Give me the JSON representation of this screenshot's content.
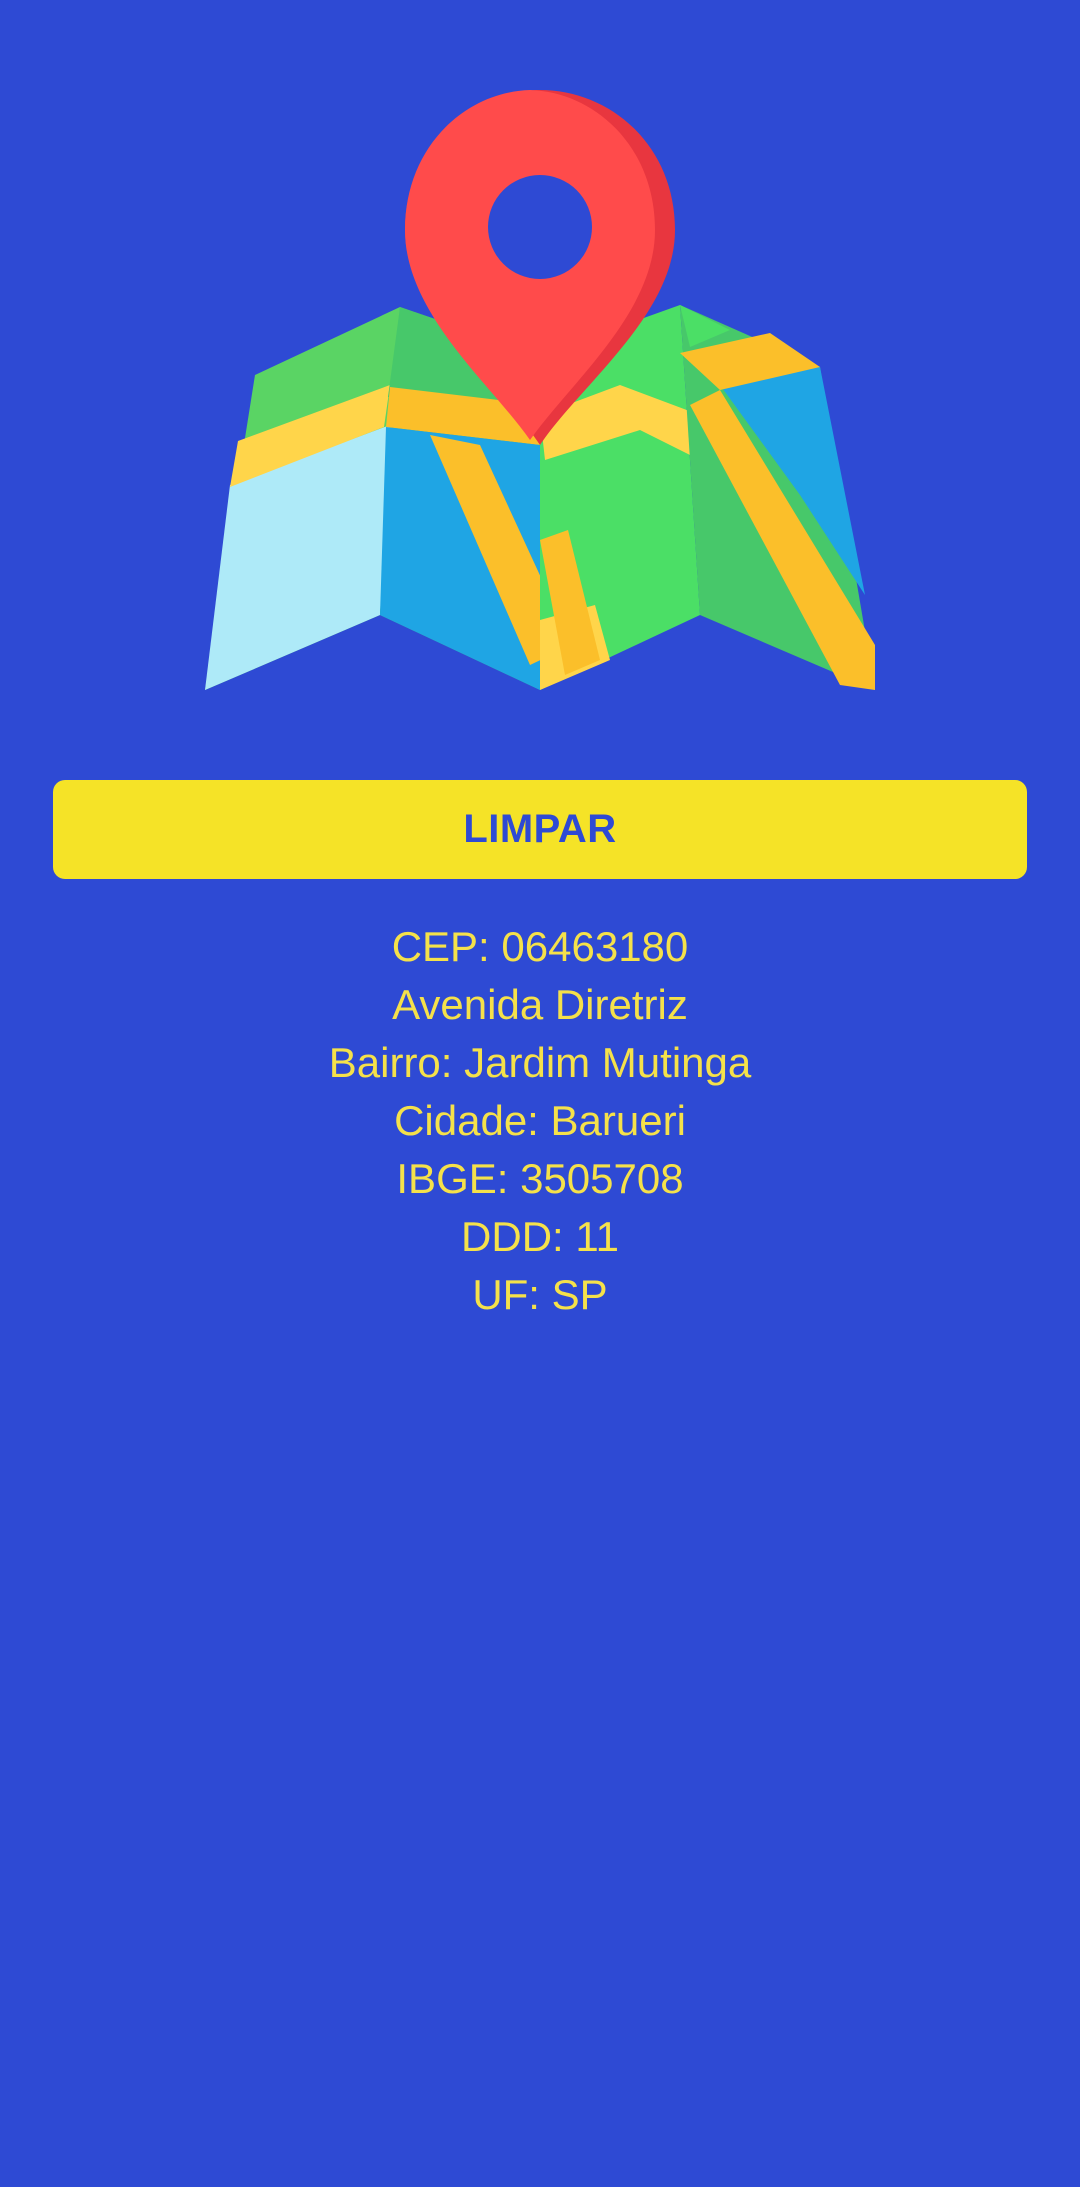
{
  "header": {
    "logo_icon": "map-location-pin-icon"
  },
  "actions": {
    "clear_label": "LIMPAR"
  },
  "result": {
    "cep": "CEP: 06463180",
    "street": "Avenida Diretriz",
    "neighborhood": "Bairro: Jardim Mutinga",
    "city": "Cidade: Barueri",
    "ibge": "IBGE: 3505708",
    "ddd": "DDD: 11",
    "uf": "UF: SP"
  },
  "colors": {
    "background": "#2e4ad4",
    "button": "#f5e327",
    "button_text": "#2e4ad4",
    "result_text": "#f5e14a",
    "pin": "#ff4b4b"
  }
}
